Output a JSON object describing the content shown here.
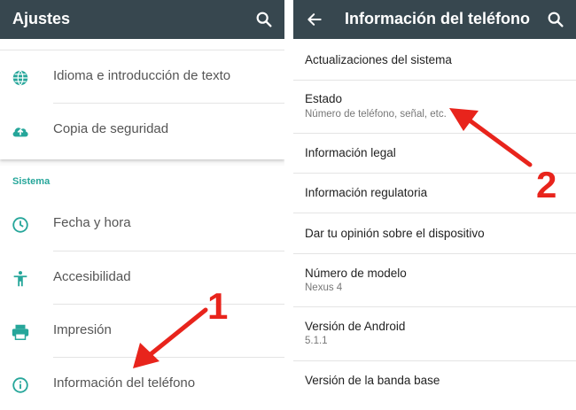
{
  "left": {
    "title": "Ajustes",
    "items_top": [
      {
        "label": "Idioma e introducción de texto",
        "icon": "globe-icon"
      },
      {
        "label": "Copia de seguridad",
        "icon": "cloud-upload-icon"
      }
    ],
    "section_label": "Sistema",
    "items_system": [
      {
        "label": "Fecha y hora",
        "icon": "clock-icon"
      },
      {
        "label": "Accesibilidad",
        "icon": "accessibility-icon"
      },
      {
        "label": "Impresión",
        "icon": "print-icon"
      },
      {
        "label": "Información del teléfono",
        "icon": "info-icon"
      }
    ]
  },
  "right": {
    "title": "Información del teléfono",
    "items": [
      {
        "title": "Actualizaciones del sistema"
      },
      {
        "title": "Estado",
        "subtitle": "Número de teléfono, señal, etc."
      },
      {
        "title": "Información legal"
      },
      {
        "title": "Información regulatoria"
      },
      {
        "title": "Dar tu opinión sobre el dispositivo"
      },
      {
        "title": "Número de modelo",
        "subtitle": "Nexus 4"
      },
      {
        "title": "Versión de Android",
        "subtitle": "5.1.1"
      },
      {
        "title": "Versión de la banda base"
      }
    ]
  },
  "annotations": {
    "step1": "1",
    "step2": "2",
    "color": "#e8241c"
  },
  "colors": {
    "appbar": "#37474f",
    "accent": "#26a69a"
  }
}
